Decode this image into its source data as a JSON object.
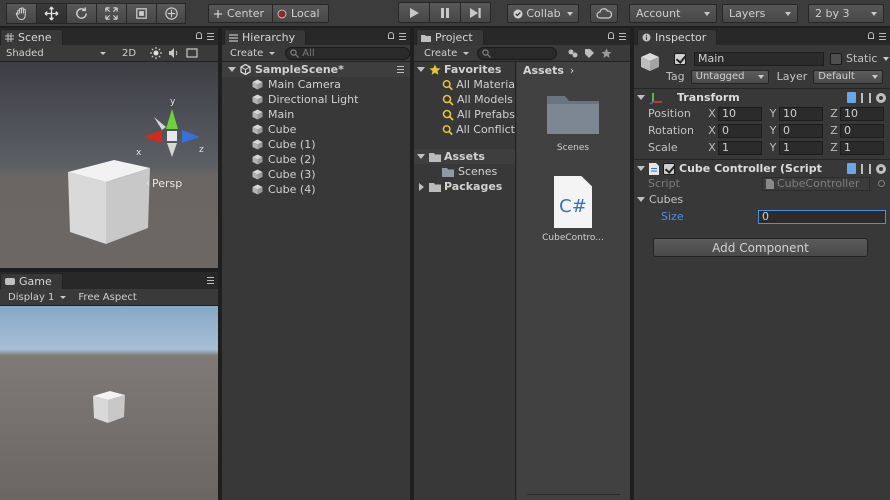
{
  "toolbar": {
    "pivot_mode": "Center",
    "pivot_space": "Local",
    "collab": "Collab",
    "account": "Account",
    "layers": "Layers",
    "layout": "2 by 3"
  },
  "scene": {
    "tab": "Scene",
    "shading": "Shaded",
    "mode_2d": "2D",
    "gizmo_y": "y",
    "gizmo_x": "x",
    "gizmo_z": "z",
    "persp": "Persp"
  },
  "game": {
    "tab": "Game",
    "display": "Display 1",
    "aspect": "Free Aspect"
  },
  "hierarchy": {
    "tab": "Hierarchy",
    "create": "Create",
    "search_placeholder": "All",
    "scene_name": "SampleScene*",
    "items": [
      "Main Camera",
      "Directional Light",
      "Main",
      "Cube",
      "Cube (1)",
      "Cube (2)",
      "Cube (3)",
      "Cube (4)"
    ]
  },
  "project": {
    "tab": "Project",
    "create": "Create",
    "favorites_label": "Favorites",
    "favorites": [
      "All Materia",
      "All Models",
      "All Prefabs",
      "All Conflict"
    ],
    "assets_label": "Assets",
    "assets_children": [
      "Scenes"
    ],
    "packages_label": "Packages",
    "breadcrumb": "Assets",
    "files": [
      {
        "name": "Scenes",
        "kind": "folder"
      },
      {
        "name": "CubeContro...",
        "kind": "csharp",
        "glyph": "C#"
      }
    ]
  },
  "inspector": {
    "tab": "Inspector",
    "object_name": "Main",
    "static_label": "Static",
    "tag_label": "Tag",
    "tag_value": "Untagged",
    "layer_label": "Layer",
    "layer_value": "Default",
    "transform_title": "Transform",
    "axis_x": "X",
    "axis_y": "Y",
    "axis_z": "Z",
    "rows": [
      {
        "label": "Position",
        "x": "10",
        "y": "10",
        "z": "10"
      },
      {
        "label": "Rotation",
        "x": "0",
        "y": "0",
        "z": "0"
      },
      {
        "label": "Scale",
        "x": "1",
        "y": "1",
        "z": "1"
      }
    ],
    "script_component_title": "Cube Controller (Script",
    "script_label": "Script",
    "script_value": "CubeController",
    "cubes_label": "Cubes",
    "size_label": "Size",
    "size_value": "0",
    "add_component": "Add Component"
  },
  "colors": {
    "accent_blue": "#4f8de0",
    "play_icon": "#c8c8c8",
    "gizmo_red": "#d5291c",
    "gizmo_green": "#6fd13a",
    "gizmo_blue": "#3a6fd8"
  }
}
